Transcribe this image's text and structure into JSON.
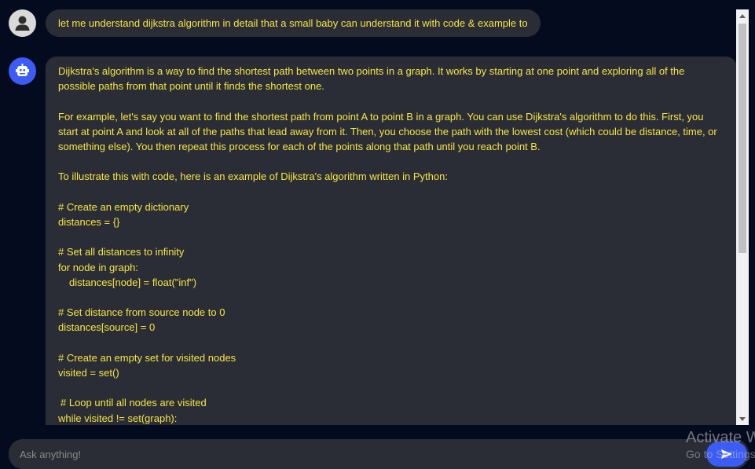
{
  "user_message": {
    "text": "let me understand dijkstra algorithm in detail that a small baby can understand it with code & example to"
  },
  "bot_message": {
    "paragraph_1": "Dijkstra's algorithm is a way to find the shortest path between two points in a graph. It works by starting at one point and exploring all of the possible paths from that point until it finds the shortest one.",
    "paragraph_2": "For example, let's say you want to find the shortest path from point A to point B in a graph. You can use Dijkstra's algorithm to do this. First, you start at point A and look at all of the paths that lead away from it. Then, you choose the path with the lowest cost (which could be distance, time, or something else). You then repeat this process for each of the points along that path until you reach point B.",
    "paragraph_3": "To illustrate this with code, here is an example of Dijkstra's algorithm written in Python:",
    "code": {
      "c1": "# Create an empty dictionary",
      "c2": "distances = {}",
      "c3": "# Set all distances to infinity",
      "c4": "for node in graph:",
      "c5": "distances[node] = float(\"inf\")",
      "c6": "# Set distance from source node to 0",
      "c7": "distances[source] = 0",
      "c8": "# Create an empty set for visited nodes",
      "c9": "visited = set()",
      "c10": "# Loop until all nodes are visited",
      "c11": "while visited != set(graph):"
    }
  },
  "input": {
    "placeholder": "Ask anything!"
  },
  "watermark": {
    "title": "Activate Windows",
    "subtitle": "Go to Settings to activate Windows."
  },
  "icons": {
    "user_avatar": "user-silhouette-icon",
    "bot_avatar": "robot-icon",
    "send": "paper-plane-icon"
  },
  "colors": {
    "background": "#050b1f",
    "bubble": "#2b2d36",
    "text": "#f5e642",
    "accent": "#3b5cf6"
  }
}
